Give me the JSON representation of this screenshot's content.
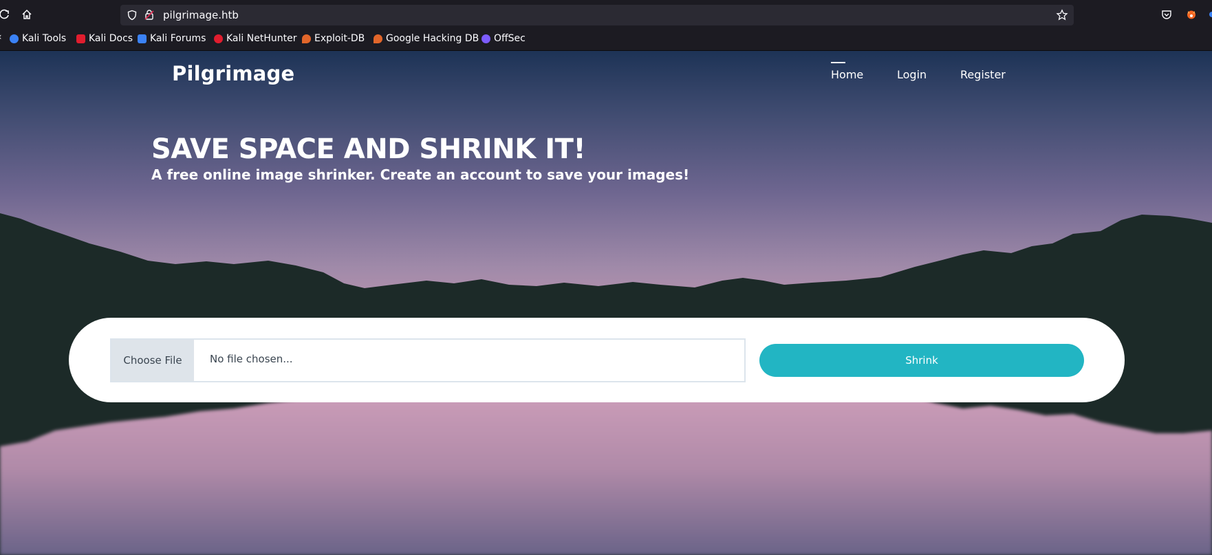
{
  "browser": {
    "url": "pilgrimage.htb",
    "bookmarks": [
      {
        "label": "Kali Tools",
        "color": "#3b82f6"
      },
      {
        "label": "Kali Docs",
        "color": "#e11d2e"
      },
      {
        "label": "Kali Forums",
        "color": "#3b82f6"
      },
      {
        "label": "Kali NetHunter",
        "color": "#e11d2e"
      },
      {
        "label": "Exploit-DB",
        "color": "#e2662a"
      },
      {
        "label": "Google Hacking DB",
        "color": "#e2662a"
      },
      {
        "label": "OffSec",
        "color": "#7c5cff"
      }
    ]
  },
  "site": {
    "logo": "Pilgrimage",
    "nav": {
      "home": "Home",
      "login": "Login",
      "register": "Register"
    },
    "hero": {
      "title": "SAVE SPACE AND SHRINK IT!",
      "subtitle": "A free online image shrinker. Create an account to save your images!"
    },
    "upload": {
      "choose_label": "Choose File",
      "status": "No file chosen...",
      "submit_label": "Shrink"
    }
  },
  "colors": {
    "accent": "#22b5c3",
    "mountain": "#1c2a28",
    "sky_top": "#1d3356",
    "sky_horizon": "#d7a6bf"
  }
}
